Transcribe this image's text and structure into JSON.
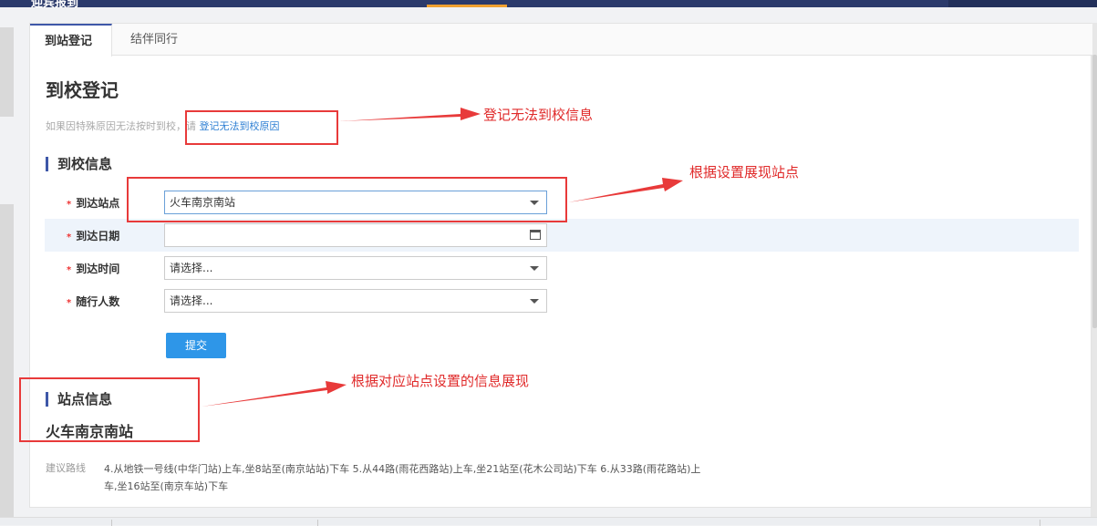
{
  "header": {
    "title": "迎宾报到"
  },
  "tabs": [
    {
      "label": "到站登记"
    },
    {
      "label": "结伴同行"
    }
  ],
  "page": {
    "heading": "到校登记",
    "hint_text": "如果因特殊原因无法按时到校，请",
    "hint_link": "登记无法到校原因"
  },
  "arrival_section": {
    "title": "到校信息",
    "fields": [
      {
        "label": "到达站点",
        "value": "火车南京南站"
      },
      {
        "label": "到达日期",
        "value": ""
      },
      {
        "label": "到达时间",
        "value": "请选择..."
      },
      {
        "label": "随行人数",
        "value": "请选择..."
      }
    ],
    "required_mark": "*",
    "submit_label": "提交"
  },
  "station_section": {
    "title": "站点信息",
    "station_name": "火车南京南站",
    "route_label": "建议路线",
    "route_text": "4.从地铁一号线(中华门站)上车,坐8站至(南京站站)下车 5.从44路(雨花西路站)上车,坐21站至(花木公司站)下车 6.从33路(雨花路站)上车,坐16站至(南京车站)下车"
  },
  "annotations": {
    "a1": "登记无法到校信息",
    "a2": "根据设置展现站点",
    "a3": "根据对应站点设置的信息展现"
  },
  "colors": {
    "annotation_red": "#e83a3a",
    "accent_blue": "#3e57a8",
    "submit_blue": "#2e96e8",
    "link_blue": "#2e7fd3"
  }
}
